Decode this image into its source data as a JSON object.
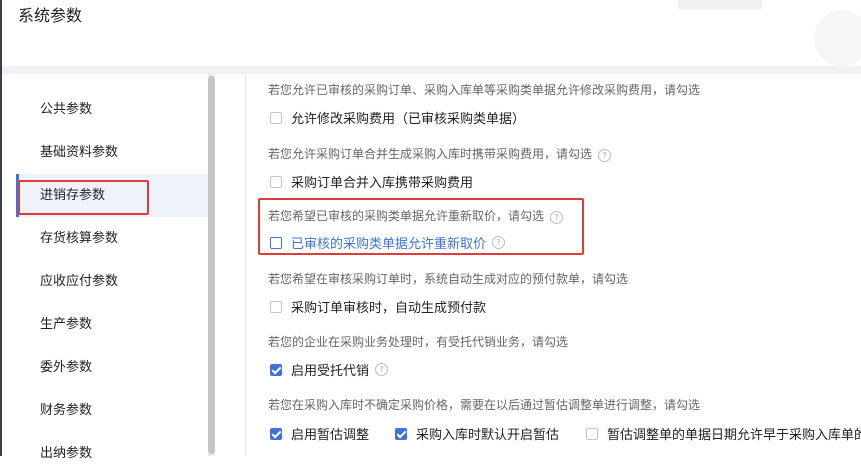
{
  "header": {
    "title": "系统参数"
  },
  "sidebar": {
    "items": [
      {
        "label": "公共参数"
      },
      {
        "label": "基础资料参数"
      },
      {
        "label": "进销存参数"
      },
      {
        "label": "存货核算参数"
      },
      {
        "label": "应收应付参数"
      },
      {
        "label": "生产参数"
      },
      {
        "label": "委外参数"
      },
      {
        "label": "财务参数"
      },
      {
        "label": "出纳参数"
      }
    ],
    "active_index": 2
  },
  "settings": {
    "s1": {
      "desc": "若您允许已审核的采购订单、采购入库单等采购类单据允许修改采购费用，请勾选",
      "option": "允许修改采购费用（已审核采购类单据）",
      "checked": false
    },
    "s2": {
      "desc": "若您允许采购订单合并生成采购入库时携带采购费用，请勾选",
      "option": "采购订单合并入库携带采购费用",
      "checked": false
    },
    "s3": {
      "desc": "若您希望已审核的采购类单据允许重新取价，请勾选",
      "option": "已审核的采购类单据允许重新取价",
      "checked": false
    },
    "s4": {
      "desc": "若您希望在审核采购订单时，系统自动生成对应的预付款单，请勾选",
      "option": "采购订单审核时，自动生成预付款",
      "checked": false
    },
    "s5": {
      "desc": "若您的企业在采购业务处理时，有受托代销业务，请勾选",
      "option": "启用受托代销",
      "checked": true
    },
    "s6": {
      "desc": "若您在采购入库时不确定采购价格，需要在以后通过暂估调整单进行调整，请勾选",
      "options": [
        {
          "label": "启用暂估调整",
          "checked": true
        },
        {
          "label": "采购入库时默认开启暂估",
          "checked": true
        },
        {
          "label": "暂估调整单的单据日期允许早于采购入库单的单",
          "checked": false
        }
      ]
    }
  },
  "colors": {
    "accent": "#3e74d8",
    "highlight_border": "#e23b3b",
    "active_bg": "#eef3fb"
  }
}
